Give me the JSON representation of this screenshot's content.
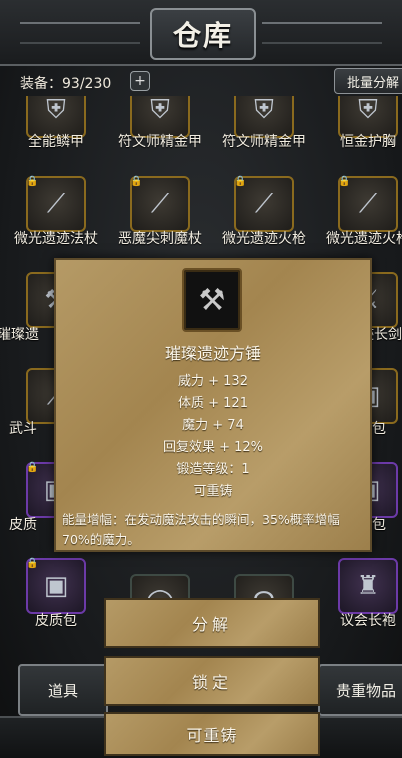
{
  "header": {
    "title": "仓库"
  },
  "inventory": {
    "count_text": "装备：93/230",
    "add_label": "+",
    "batch_label": "批量分解"
  },
  "grid": {
    "row1_names": [
      "全能鳞甲",
      "符文师精金甲",
      "符文师精金甲",
      "恒金护胸"
    ],
    "row2_names": [
      "微光遗迹法杖",
      "恶魔尖刺魔杖",
      "微光遗迹火枪",
      "微光遗迹火枪"
    ],
    "row3_left": "璀璨遗",
    "row3_right": "迹长剑",
    "row4_left": "武斗",
    "row4_right": "包",
    "row5_left": "皮质",
    "row5_right": "包",
    "row6_names": [
      "皮质包",
      "议会长袍"
    ]
  },
  "tooltip": {
    "icon": "hammer-icon",
    "name": "璀璨遗迹方锤",
    "stats": [
      "威力 + 132",
      "体质 + 121",
      "魔力 + 74",
      "回复效果 + 12%",
      "锻造等级：1",
      "可重铸"
    ],
    "description": "能量增幅：在发动魔法攻击的瞬间，35%概率增幅70%的魔力。"
  },
  "actions": {
    "decompose": "分解",
    "lock": "锁定",
    "reforge": "可重铸"
  },
  "tabs": {
    "items": "道具",
    "valuables": "贵重物品"
  },
  "colors": {
    "parchment": "#a3854f",
    "gold_border": "#8a6a1e",
    "purple_border": "#6c3aa8"
  }
}
